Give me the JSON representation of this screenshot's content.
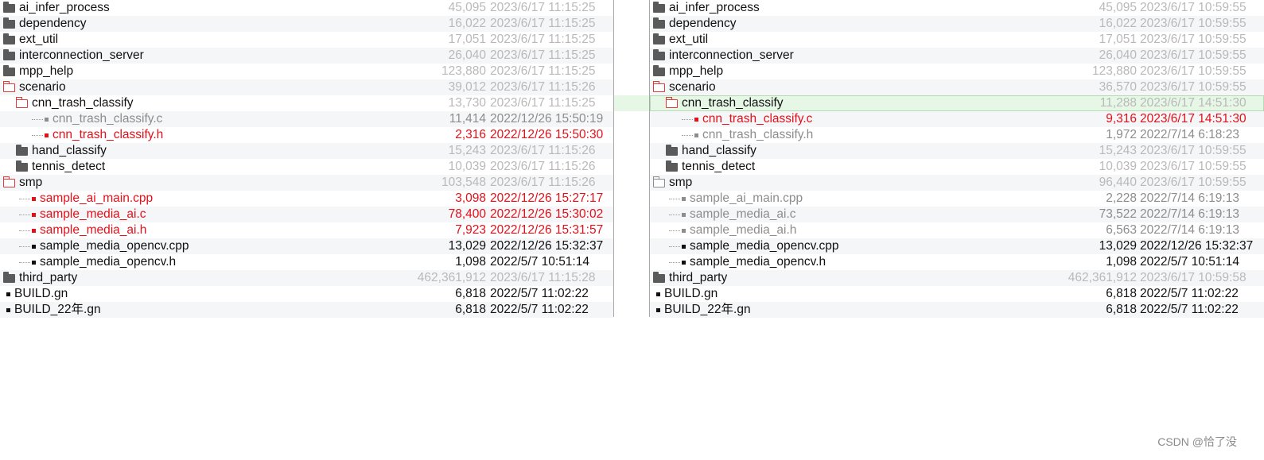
{
  "left": [
    {
      "name": "ai_infer_process",
      "size": "45,095",
      "date": "2023/6/17 11:15:25",
      "icon": "folder",
      "style": "gray",
      "indent": 0
    },
    {
      "name": "dependency",
      "size": "16,022",
      "date": "2023/6/17 11:15:25",
      "icon": "folder",
      "style": "gray",
      "indent": 0
    },
    {
      "name": "ext_util",
      "size": "17,051",
      "date": "2023/6/17 11:15:25",
      "icon": "folder",
      "style": "gray",
      "indent": 0
    },
    {
      "name": "interconnection_server",
      "size": "26,040",
      "date": "2023/6/17 11:15:25",
      "icon": "folder",
      "style": "gray",
      "indent": 0
    },
    {
      "name": "mpp_help",
      "size": "123,880",
      "date": "2023/6/17 11:15:25",
      "icon": "folder",
      "style": "gray",
      "indent": 0
    },
    {
      "name": "scenario",
      "size": "39,012",
      "date": "2023/6/17 11:15:26",
      "icon": "folder-open",
      "style": "gray",
      "indent": 0
    },
    {
      "name": "cnn_trash_classify",
      "size": "13,730",
      "date": "2023/6/17 11:15:25",
      "icon": "folder-open",
      "style": "gray",
      "indent": 1
    },
    {
      "name": "cnn_trash_classify.c",
      "size": "11,414",
      "date": "2022/12/26 15:50:19",
      "icon": "file-gray",
      "style": "dim",
      "indent": 2
    },
    {
      "name": "cnn_trash_classify.h",
      "size": "2,316",
      "date": "2022/12/26 15:50:30",
      "icon": "file-red",
      "style": "red",
      "indent": 2
    },
    {
      "name": "hand_classify",
      "size": "15,243",
      "date": "2023/6/17 11:15:26",
      "icon": "folder",
      "style": "gray",
      "indent": 1
    },
    {
      "name": "tennis_detect",
      "size": "10,039",
      "date": "2023/6/17 11:15:26",
      "icon": "folder",
      "style": "gray",
      "indent": 1
    },
    {
      "name": "smp",
      "size": "103,548",
      "date": "2023/6/17 11:15:26",
      "icon": "folder-open",
      "style": "gray",
      "indent": 0
    },
    {
      "name": "sample_ai_main.cpp",
      "size": "3,098",
      "date": "2022/12/26 15:27:17",
      "icon": "file-red",
      "style": "red",
      "indent": 1
    },
    {
      "name": "sample_media_ai.c",
      "size": "78,400",
      "date": "2022/12/26 15:30:02",
      "icon": "file-red",
      "style": "red",
      "indent": 1
    },
    {
      "name": "sample_media_ai.h",
      "size": "7,923",
      "date": "2022/12/26 15:31:57",
      "icon": "file-red",
      "style": "red",
      "indent": 1
    },
    {
      "name": "sample_media_opencv.cpp",
      "size": "13,029",
      "date": "2022/12/26 15:32:37",
      "icon": "file",
      "style": "blk",
      "indent": 1
    },
    {
      "name": "sample_media_opencv.h",
      "size": "1,098",
      "date": "2022/5/7 10:51:14",
      "icon": "file",
      "style": "blk",
      "indent": 1
    },
    {
      "name": "third_party",
      "size": "462,361,912",
      "date": "2023/6/17 11:15:28",
      "icon": "folder",
      "style": "gray",
      "indent": 0
    },
    {
      "name": "BUILD.gn",
      "size": "6,818",
      "date": "2022/5/7 11:02:22",
      "icon": "file",
      "style": "blk",
      "indent": 0
    },
    {
      "name": "BUILD_22年.gn",
      "size": "6,818",
      "date": "2022/5/7 11:02:22",
      "icon": "file",
      "style": "blk",
      "indent": 0
    }
  ],
  "right": [
    {
      "name": "ai_infer_process",
      "size": "45,095",
      "date": "2023/6/17 10:59:55",
      "icon": "folder",
      "style": "gray",
      "indent": 0
    },
    {
      "name": "dependency",
      "size": "16,022",
      "date": "2023/6/17 10:59:55",
      "icon": "folder",
      "style": "gray",
      "indent": 0
    },
    {
      "name": "ext_util",
      "size": "17,051",
      "date": "2023/6/17 10:59:55",
      "icon": "folder",
      "style": "gray",
      "indent": 0
    },
    {
      "name": "interconnection_server",
      "size": "26,040",
      "date": "2023/6/17 10:59:55",
      "icon": "folder",
      "style": "gray",
      "indent": 0
    },
    {
      "name": "mpp_help",
      "size": "123,880",
      "date": "2023/6/17 10:59:55",
      "icon": "folder",
      "style": "gray",
      "indent": 0
    },
    {
      "name": "scenario",
      "size": "36,570",
      "date": "2023/6/17 10:59:55",
      "icon": "folder-open",
      "style": "gray",
      "indent": 0
    },
    {
      "name": "cnn_trash_classify",
      "size": "11,288",
      "date": "2023/6/17 14:51:30",
      "icon": "folder-open",
      "style": "gray",
      "indent": 1,
      "selected": true
    },
    {
      "name": "cnn_trash_classify.c",
      "size": "9,316",
      "date": "2023/6/17 14:51:30",
      "icon": "file-red",
      "style": "red",
      "indent": 2
    },
    {
      "name": "cnn_trash_classify.h",
      "size": "1,972",
      "date": "2022/7/14 6:18:23",
      "icon": "file-gray",
      "style": "dim",
      "indent": 2
    },
    {
      "name": "hand_classify",
      "size": "15,243",
      "date": "2023/6/17 10:59:55",
      "icon": "folder",
      "style": "gray",
      "indent": 1
    },
    {
      "name": "tennis_detect",
      "size": "10,039",
      "date": "2023/6/17 10:59:55",
      "icon": "folder",
      "style": "gray",
      "indent": 1
    },
    {
      "name": "smp",
      "size": "96,440",
      "date": "2023/6/17 10:59:55",
      "icon": "folder-open-gray",
      "style": "gray",
      "indent": 0
    },
    {
      "name": "sample_ai_main.cpp",
      "size": "2,228",
      "date": "2022/7/14 6:19:13",
      "icon": "file-gray",
      "style": "dim",
      "indent": 1
    },
    {
      "name": "sample_media_ai.c",
      "size": "73,522",
      "date": "2022/7/14 6:19:13",
      "icon": "file-gray",
      "style": "dim",
      "indent": 1
    },
    {
      "name": "sample_media_ai.h",
      "size": "6,563",
      "date": "2022/7/14 6:19:13",
      "icon": "file-gray",
      "style": "dim",
      "indent": 1
    },
    {
      "name": "sample_media_opencv.cpp",
      "size": "13,029",
      "date": "2022/12/26 15:32:37",
      "icon": "file",
      "style": "blk",
      "indent": 1
    },
    {
      "name": "sample_media_opencv.h",
      "size": "1,098",
      "date": "2022/5/7 10:51:14",
      "icon": "file",
      "style": "blk",
      "indent": 1
    },
    {
      "name": "third_party",
      "size": "462,361,912",
      "date": "2023/6/17 10:59:58",
      "icon": "folder",
      "style": "gray",
      "indent": 0
    },
    {
      "name": "BUILD.gn",
      "size": "6,818",
      "date": "2022/5/7 11:02:22",
      "icon": "file",
      "style": "blk",
      "indent": 0
    },
    {
      "name": "BUILD_22年.gn",
      "size": "6,818",
      "date": "2022/5/7 11:02:22",
      "icon": "file",
      "style": "blk",
      "indent": 0
    }
  ],
  "watermark": "CSDN @恰了没",
  "colors": {
    "changed": "#e4101a",
    "unchanged": "#b9b9b9",
    "orphan": "#8d8d8d",
    "same": "#111111",
    "selected_bg": "#e6f7e6"
  }
}
